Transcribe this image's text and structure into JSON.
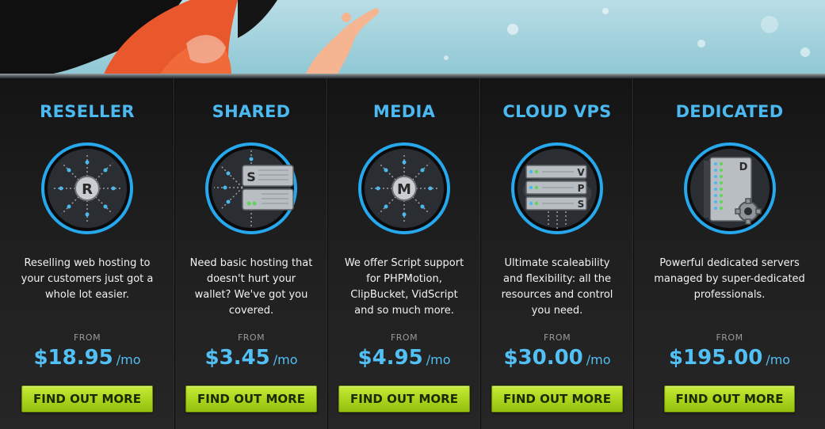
{
  "colors": {
    "accent_blue": "#4bb8f0",
    "button_green": "#a9d41c",
    "panel_dark": "#1e1e1e"
  },
  "plans": [
    {
      "title": "RESELLER",
      "icon": "reseller-server-icon",
      "icon_letter": "R",
      "description": "Reselling web hosting to your customers just got a whole lot easier.",
      "from_label": "FROM",
      "price": "$18.95",
      "unit": "/mo",
      "button_label": "FIND OUT MORE"
    },
    {
      "title": "SHARED",
      "icon": "shared-server-icon",
      "icon_letter": "S",
      "description": "Need basic hosting that doesn't hurt your wallet? We've got you covered.",
      "from_label": "FROM",
      "price": "$3.45",
      "unit": "/mo",
      "button_label": "FIND OUT MORE"
    },
    {
      "title": "MEDIA",
      "icon": "media-server-icon",
      "icon_letter": "M",
      "description": "We offer Script support for PHPMotion, ClipBucket, VidScript and so much more.",
      "from_label": "FROM",
      "price": "$4.95",
      "unit": "/mo",
      "button_label": "FIND OUT MORE"
    },
    {
      "title": "CLOUD VPS",
      "icon": "cloud-vps-server-icon",
      "icon_letters": [
        "V",
        "P",
        "S"
      ],
      "description": "Ultimate scaleability and flexibility: all the resources and control you need.",
      "from_label": "FROM",
      "price": "$30.00",
      "unit": "/mo",
      "button_label": "FIND OUT MORE"
    },
    {
      "title": "DEDICATED",
      "icon": "dedicated-server-icon",
      "icon_letter": "D",
      "description": "Powerful dedicated servers managed by super-dedicated professionals.",
      "from_label": "FROM",
      "price": "$195.00",
      "unit": "/mo",
      "button_label": "FIND OUT MORE"
    }
  ]
}
